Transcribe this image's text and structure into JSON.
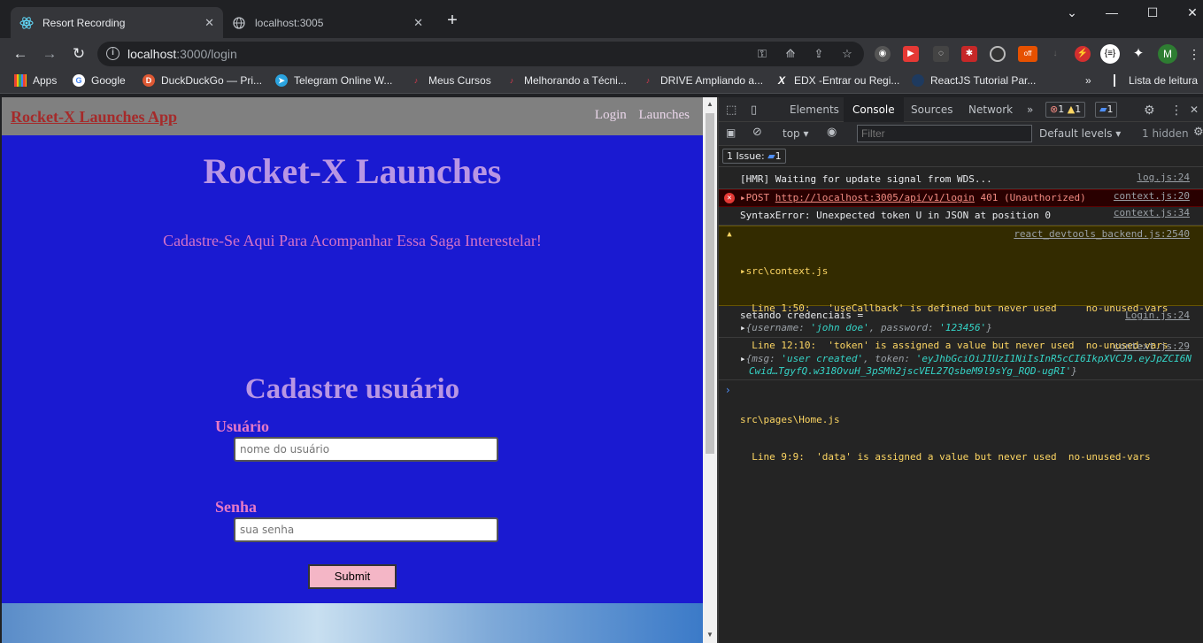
{
  "browser": {
    "tabs": [
      {
        "title": "Resort Recording",
        "active": true
      },
      {
        "title": "localhost:3005",
        "active": false
      }
    ],
    "url_host": "localhost",
    "url_path": ":3000/login",
    "bookmarks": [
      "Apps",
      "Google",
      "DuckDuckGo — Pri...",
      "Telegram Online W...",
      "Meus Cursos",
      "Melhorando a Técni...",
      "DRIVE Ampliando a...",
      "EDX -Entrar ou Regi...",
      "ReactJS Tutorial Par..."
    ],
    "reading_list": "Lista de leitura",
    "profile_initial": "M",
    "ext_off_label": "off"
  },
  "site": {
    "brand": "Rocket-X Launches App",
    "nav": [
      "Login",
      "Launches"
    ],
    "heading": "Rocket-X Launches",
    "tagline": "Cadastre-Se Aqui Para Acompanhar Essa Saga Interestelar!",
    "form_title": "Cadastre usuário",
    "user_label": "Usuário",
    "user_placeholder": "nome do usuário",
    "pass_label": "Senha",
    "pass_placeholder": "sua senha",
    "submit": "Submit"
  },
  "devtools": {
    "tabs": [
      "Elements",
      "Console",
      "Sources",
      "Network"
    ],
    "active_tab": "Console",
    "error_count": "1",
    "warn_count": "1",
    "info_count": "1",
    "context": "top",
    "filter_placeholder": "Filter",
    "levels": "Default levels",
    "hidden": "1 hidden",
    "issues_label": "1 Issue:",
    "issues_count": "1",
    "messages": {
      "m1": {
        "text": "[HMR] Waiting for update signal from WDS...",
        "src": "log.js:24"
      },
      "m2": {
        "prefix": "POST",
        "url": "http://localhost:3005/api/v1/login",
        "status": "401 (Unauthorized)",
        "src": "context.js:20"
      },
      "m3": {
        "text": "SyntaxError: Unexpected token U in JSON at position 0",
        "src": "context.js:34"
      },
      "m4": {
        "file1": "src\\context.js",
        "src": "react_devtools_backend.js:2540",
        "line1": "  Line 1:50:   'useCallback' is defined but never used     no-unused-vars",
        "line2": "  Line 12:10:  'token' is assigned a value but never used  no-unused-vars",
        "file2": "src\\pages\\Home.js",
        "line3": "  Line 9:9:  'data' is assigned a value but never used  no-unused-vars"
      },
      "m5": {
        "text": "setando credenciais =",
        "src": "Login.js:24",
        "k1": "username",
        "v1": "'john doe'",
        "k2": "password",
        "v2": "'123456'"
      },
      "m6": {
        "src": "context.js:29",
        "k1": "msg",
        "v1": "'user created'",
        "k2": "token",
        "v2a": "'eyJhbGciOiJIUzI1NiIsInR5cCI6IkpXVCJ9.eyJpZCI6N",
        "v2b": "Cwid…TgyfQ.w318OvuH_3pSMh2jscVEL27QsbeM9l9sYg_RQD-ugRI'"
      }
    }
  },
  "colors": {
    "page_bg": "#1a1ad1",
    "navbar": "#808080",
    "brand": "#a52a2a",
    "heading": "#b896e4",
    "accent": "#e579c6",
    "submit": "#f4b6c6"
  }
}
